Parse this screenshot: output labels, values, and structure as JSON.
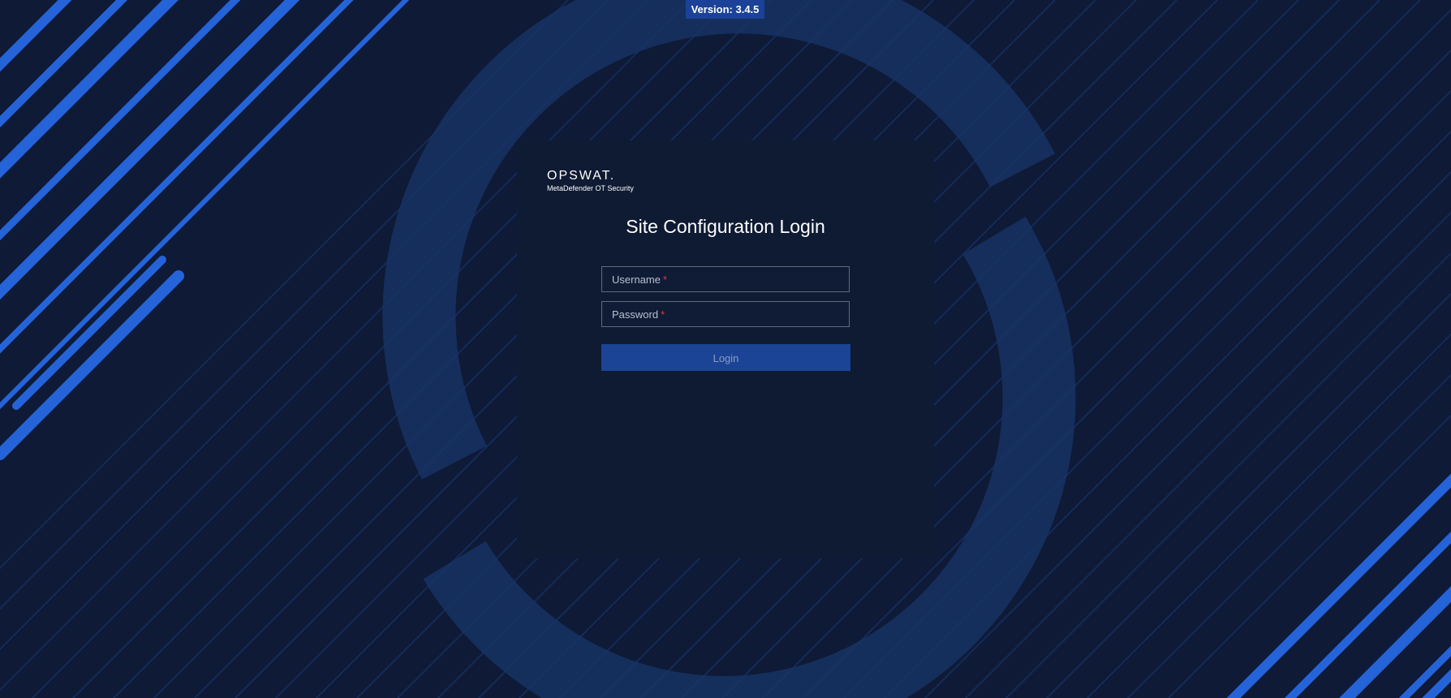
{
  "version": {
    "label": "Version: 3.4.5"
  },
  "logo": {
    "brand": "OPSWAT.",
    "product": "MetaDefender OT Security"
  },
  "login": {
    "title": "Site Configuration Login",
    "username_label": "Username",
    "password_label": "Password",
    "required_marker": "*",
    "button_label": "Login"
  },
  "colors": {
    "background": "#0e1a36",
    "card": "#0f1a33",
    "accent": "#1c4496",
    "stripe": "#2563d9",
    "required": "#e53935"
  },
  "icons": {
    "background": "diagonal-stripes-and-ring-pattern"
  }
}
